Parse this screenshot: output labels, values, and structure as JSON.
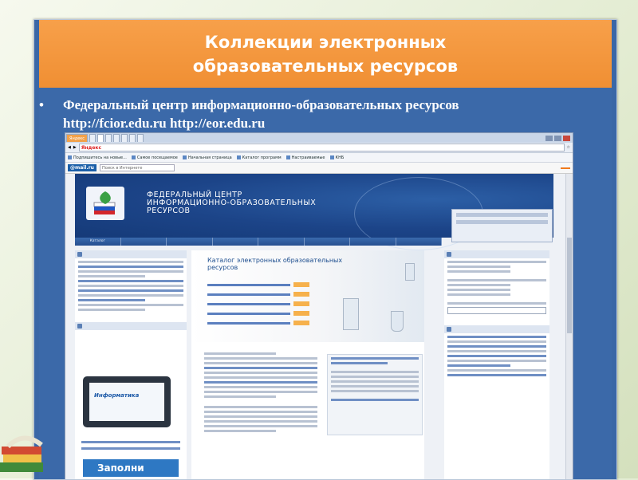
{
  "slide": {
    "title_line1": "Коллекции электронных",
    "title_line2": "образовательных ресурсов",
    "bullet_line1": "Федеральный центр информационно-образовательных ресурсов",
    "bullet_line2": "http://fcior.edu.ru http://eor.edu.ru",
    "bullet_symbol": "•",
    "colors": {
      "title_bg": "#f0903a",
      "body_bg": "#3b69a9",
      "text": "#ffffff"
    }
  },
  "browser": {
    "tabs": [
      "Яндекс",
      "",
      "",
      "",
      "",
      "",
      "",
      "",
      "",
      ""
    ],
    "address_brand": "Яндекс",
    "bookmarks": [
      "Подпишитесь на новые...",
      "Самое посещаемое",
      "Начальная страница",
      "",
      "Каталог программ",
      "",
      "Настраиваемые",
      "КНБ"
    ],
    "mail_logo": "@mail.ru",
    "mail_search_placeholder": "Поиск в Интернете",
    "site": {
      "title_line1": "ФЕДЕРАЛЬНЫЙ ЦЕНТР",
      "title_line2": "ИНФОРМАЦИОННО-ОБРАЗОВАТЕЛЬНЫХ",
      "title_line3": "РЕСУРСОВ",
      "nav": [
        "Каталог",
        "",
        "",
        "",
        "",
        "",
        "",
        ""
      ],
      "catalog_title_line1": "Каталог электронных образовательных",
      "catalog_title_line2": "ресурсов",
      "tablet_label": "Информатика",
      "fill_banner": "Заполни"
    }
  }
}
